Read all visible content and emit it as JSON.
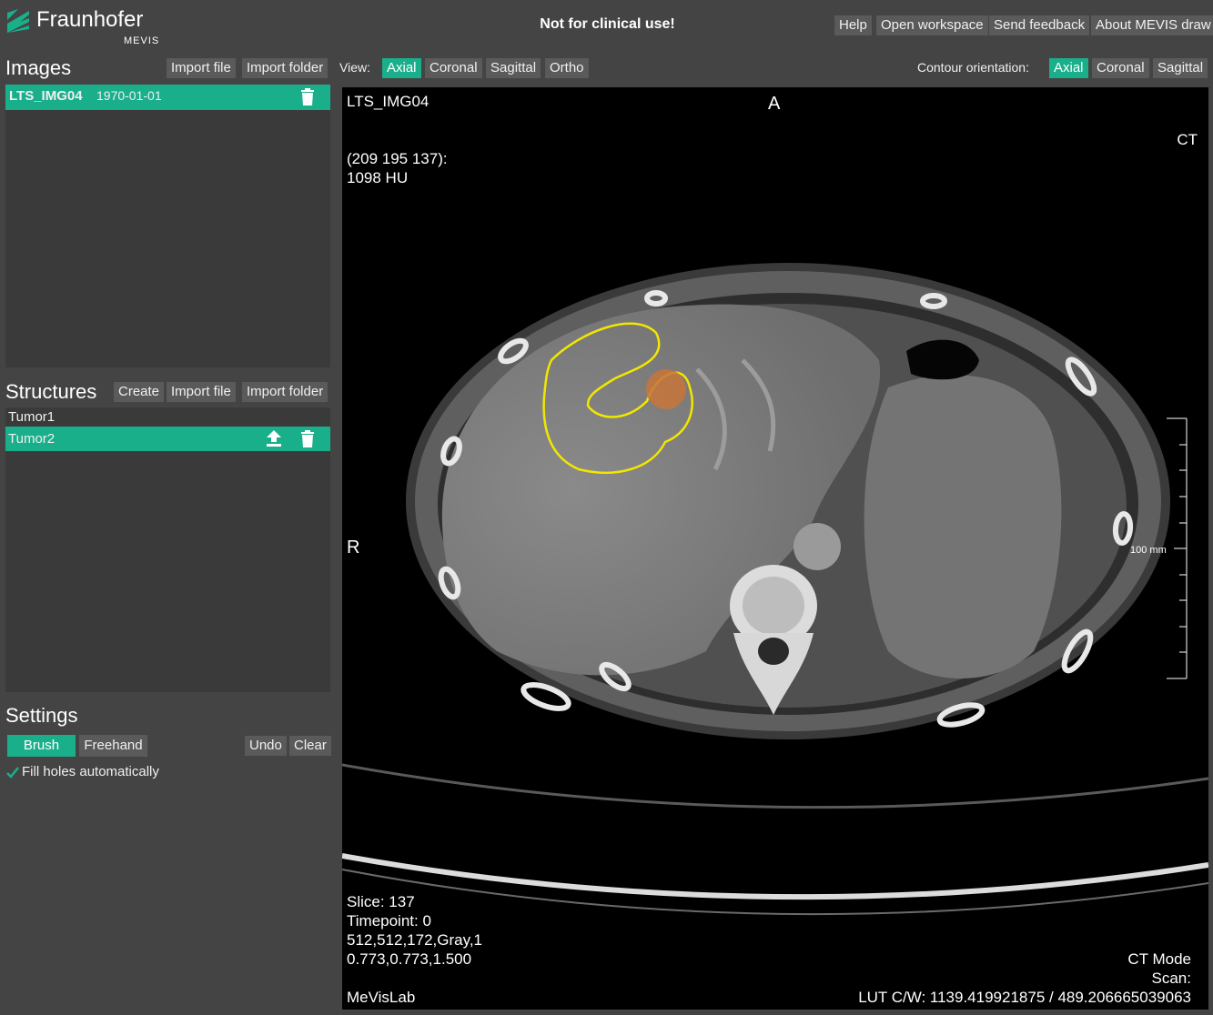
{
  "brand": {
    "name": "Fraunhofer",
    "sub": "MEVIS"
  },
  "header": {
    "warning": "Not for clinical use!",
    "buttons": [
      "Help",
      "Open workspace",
      "Send feedback",
      "About MEVIS draw"
    ]
  },
  "images": {
    "title": "Images",
    "import_file": "Import file",
    "import_folder": "Import folder",
    "items": [
      {
        "name": "LTS_IMG04",
        "date": "1970-01-01"
      }
    ]
  },
  "structures": {
    "title": "Structures",
    "create": "Create",
    "import_file": "Import file",
    "import_folder": "Import folder",
    "items": [
      "Tumor1",
      "Tumor2"
    ],
    "selected": "Tumor2"
  },
  "settings": {
    "title": "Settings",
    "brush": "Brush",
    "freehand": "Freehand",
    "undo": "Undo",
    "clear": "Clear",
    "fill_holes": "Fill holes automatically",
    "fill_holes_checked": true
  },
  "view": {
    "label": "View:",
    "options": [
      "Axial",
      "Coronal",
      "Sagittal",
      "Ortho"
    ],
    "selected": "Axial"
  },
  "contour": {
    "label": "Contour orientation:",
    "options": [
      "Axial",
      "Coronal",
      "Sagittal"
    ],
    "selected": "Axial"
  },
  "viewer": {
    "image_name": "LTS_IMG04",
    "orientation_top": "A",
    "orientation_left": "R",
    "modality": "CT",
    "coord_line1": "(209 195 137):",
    "coord_line2": "1098 HU",
    "scale_label": "100 mm",
    "slice": "Slice: 137",
    "timepoint": "Timepoint: 0",
    "dims": "512,512,172,Gray,1",
    "spacing": "0.773,0.773,1.500",
    "engine": "MeVisLab",
    "mode": "CT Mode",
    "scan": "Scan:",
    "lut": "LUT C/W: 1139.419921875 / 489.206665039063"
  },
  "colors": {
    "accent": "#1aaf8b",
    "contour": "#f2e600",
    "brush": "#c8763a"
  }
}
